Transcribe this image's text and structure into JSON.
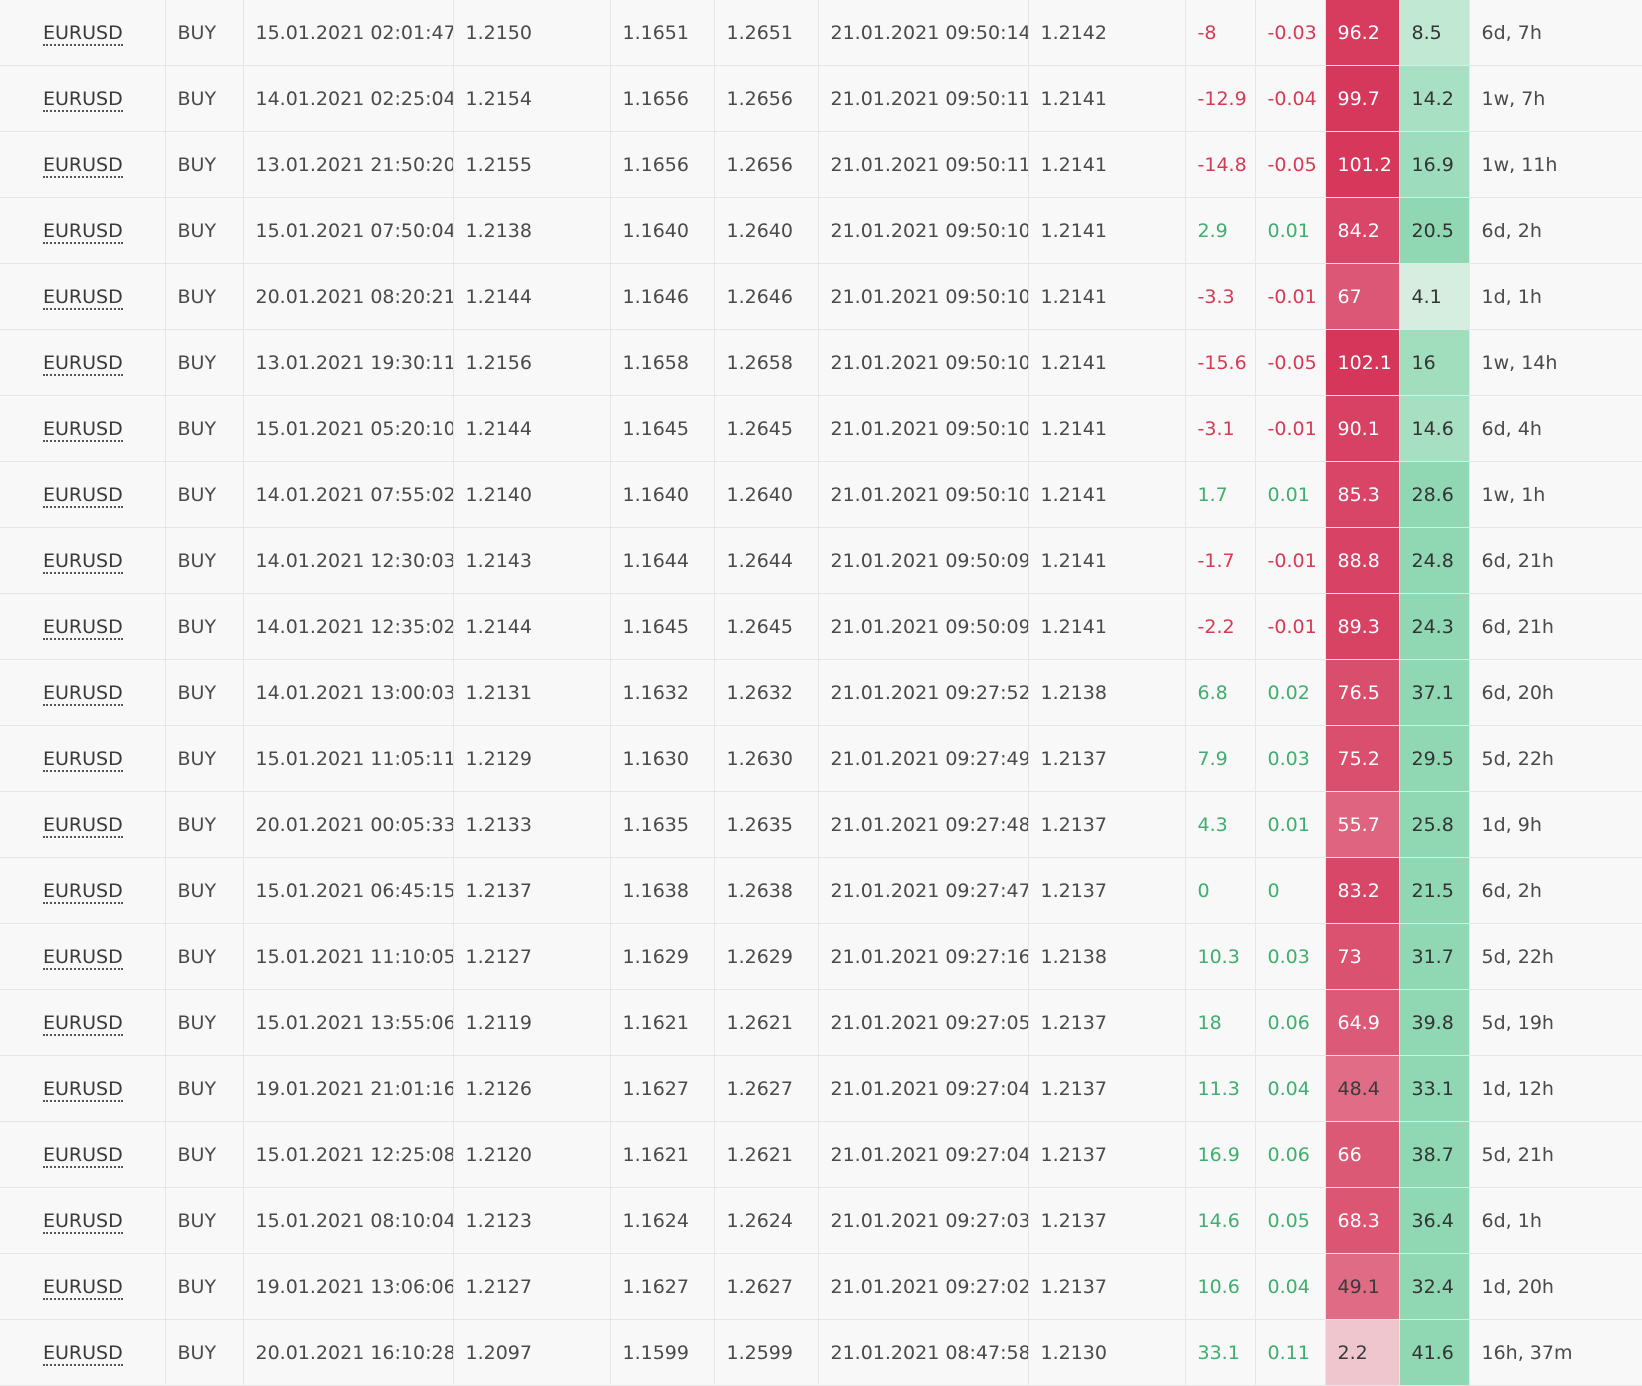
{
  "colors": {
    "negative_text": "#d63b55",
    "positive_text": "#3fae6e",
    "risk_heat_low": "#f0c9d1",
    "risk_heat_high": "#d6365a",
    "reward_heat_low": "#d5eee0",
    "reward_heat_high": "#8fd8b3"
  },
  "rows": [
    {
      "symbol": "EURUSD",
      "side": "BUY",
      "open_time": "15.01.2021 02:01:47",
      "open_price": "1.2150",
      "stop_loss": "1.1651",
      "take_profit": "1.2651",
      "close_time": "21.01.2021 09:50:14",
      "close_price": "1.2142",
      "pips": "-8",
      "profit": "-0.03",
      "risk": "96.2",
      "reward": "8.5",
      "duration": "6d, 7h"
    },
    {
      "symbol": "EURUSD",
      "side": "BUY",
      "open_time": "14.01.2021 02:25:04",
      "open_price": "1.2154",
      "stop_loss": "1.1656",
      "take_profit": "1.2656",
      "close_time": "21.01.2021 09:50:11",
      "close_price": "1.2141",
      "pips": "-12.9",
      "profit": "-0.04",
      "risk": "99.7",
      "reward": "14.2",
      "duration": "1w, 7h"
    },
    {
      "symbol": "EURUSD",
      "side": "BUY",
      "open_time": "13.01.2021 21:50:20",
      "open_price": "1.2155",
      "stop_loss": "1.1656",
      "take_profit": "1.2656",
      "close_time": "21.01.2021 09:50:11",
      "close_price": "1.2141",
      "pips": "-14.8",
      "profit": "-0.05",
      "risk": "101.2",
      "reward": "16.9",
      "duration": "1w, 11h"
    },
    {
      "symbol": "EURUSD",
      "side": "BUY",
      "open_time": "15.01.2021 07:50:04",
      "open_price": "1.2138",
      "stop_loss": "1.1640",
      "take_profit": "1.2640",
      "close_time": "21.01.2021 09:50:10",
      "close_price": "1.2141",
      "pips": "2.9",
      "profit": "0.01",
      "risk": "84.2",
      "reward": "20.5",
      "duration": "6d, 2h"
    },
    {
      "symbol": "EURUSD",
      "side": "BUY",
      "open_time": "20.01.2021 08:20:21",
      "open_price": "1.2144",
      "stop_loss": "1.1646",
      "take_profit": "1.2646",
      "close_time": "21.01.2021 09:50:10",
      "close_price": "1.2141",
      "pips": "-3.3",
      "profit": "-0.01",
      "risk": "67",
      "reward": "4.1",
      "duration": "1d, 1h"
    },
    {
      "symbol": "EURUSD",
      "side": "BUY",
      "open_time": "13.01.2021 19:30:11",
      "open_price": "1.2156",
      "stop_loss": "1.1658",
      "take_profit": "1.2658",
      "close_time": "21.01.2021 09:50:10",
      "close_price": "1.2141",
      "pips": "-15.6",
      "profit": "-0.05",
      "risk": "102.1",
      "reward": "16",
      "duration": "1w, 14h"
    },
    {
      "symbol": "EURUSD",
      "side": "BUY",
      "open_time": "15.01.2021 05:20:10",
      "open_price": "1.2144",
      "stop_loss": "1.1645",
      "take_profit": "1.2645",
      "close_time": "21.01.2021 09:50:10",
      "close_price": "1.2141",
      "pips": "-3.1",
      "profit": "-0.01",
      "risk": "90.1",
      "reward": "14.6",
      "duration": "6d, 4h"
    },
    {
      "symbol": "EURUSD",
      "side": "BUY",
      "open_time": "14.01.2021 07:55:02",
      "open_price": "1.2140",
      "stop_loss": "1.1640",
      "take_profit": "1.2640",
      "close_time": "21.01.2021 09:50:10",
      "close_price": "1.2141",
      "pips": "1.7",
      "profit": "0.01",
      "risk": "85.3",
      "reward": "28.6",
      "duration": "1w, 1h"
    },
    {
      "symbol": "EURUSD",
      "side": "BUY",
      "open_time": "14.01.2021 12:30:03",
      "open_price": "1.2143",
      "stop_loss": "1.1644",
      "take_profit": "1.2644",
      "close_time": "21.01.2021 09:50:09",
      "close_price": "1.2141",
      "pips": "-1.7",
      "profit": "-0.01",
      "risk": "88.8",
      "reward": "24.8",
      "duration": "6d, 21h"
    },
    {
      "symbol": "EURUSD",
      "side": "BUY",
      "open_time": "14.01.2021 12:35:02",
      "open_price": "1.2144",
      "stop_loss": "1.1645",
      "take_profit": "1.2645",
      "close_time": "21.01.2021 09:50:09",
      "close_price": "1.2141",
      "pips": "-2.2",
      "profit": "-0.01",
      "risk": "89.3",
      "reward": "24.3",
      "duration": "6d, 21h"
    },
    {
      "symbol": "EURUSD",
      "side": "BUY",
      "open_time": "14.01.2021 13:00:03",
      "open_price": "1.2131",
      "stop_loss": "1.1632",
      "take_profit": "1.2632",
      "close_time": "21.01.2021 09:27:52",
      "close_price": "1.2138",
      "pips": "6.8",
      "profit": "0.02",
      "risk": "76.5",
      "reward": "37.1",
      "duration": "6d, 20h"
    },
    {
      "symbol": "EURUSD",
      "side": "BUY",
      "open_time": "15.01.2021 11:05:11",
      "open_price": "1.2129",
      "stop_loss": "1.1630",
      "take_profit": "1.2630",
      "close_time": "21.01.2021 09:27:49",
      "close_price": "1.2137",
      "pips": "7.9",
      "profit": "0.03",
      "risk": "75.2",
      "reward": "29.5",
      "duration": "5d, 22h"
    },
    {
      "symbol": "EURUSD",
      "side": "BUY",
      "open_time": "20.01.2021 00:05:33",
      "open_price": "1.2133",
      "stop_loss": "1.1635",
      "take_profit": "1.2635",
      "close_time": "21.01.2021 09:27:48",
      "close_price": "1.2137",
      "pips": "4.3",
      "profit": "0.01",
      "risk": "55.7",
      "reward": "25.8",
      "duration": "1d, 9h"
    },
    {
      "symbol": "EURUSD",
      "side": "BUY",
      "open_time": "15.01.2021 06:45:15",
      "open_price": "1.2137",
      "stop_loss": "1.1638",
      "take_profit": "1.2638",
      "close_time": "21.01.2021 09:27:47",
      "close_price": "1.2137",
      "pips": "0",
      "profit": "0",
      "risk": "83.2",
      "reward": "21.5",
      "duration": "6d, 2h"
    },
    {
      "symbol": "EURUSD",
      "side": "BUY",
      "open_time": "15.01.2021 11:10:05",
      "open_price": "1.2127",
      "stop_loss": "1.1629",
      "take_profit": "1.2629",
      "close_time": "21.01.2021 09:27:16",
      "close_price": "1.2138",
      "pips": "10.3",
      "profit": "0.03",
      "risk": "73",
      "reward": "31.7",
      "duration": "5d, 22h"
    },
    {
      "symbol": "EURUSD",
      "side": "BUY",
      "open_time": "15.01.2021 13:55:06",
      "open_price": "1.2119",
      "stop_loss": "1.1621",
      "take_profit": "1.2621",
      "close_time": "21.01.2021 09:27:05",
      "close_price": "1.2137",
      "pips": "18",
      "profit": "0.06",
      "risk": "64.9",
      "reward": "39.8",
      "duration": "5d, 19h"
    },
    {
      "symbol": "EURUSD",
      "side": "BUY",
      "open_time": "19.01.2021 21:01:16",
      "open_price": "1.2126",
      "stop_loss": "1.1627",
      "take_profit": "1.2627",
      "close_time": "21.01.2021 09:27:04",
      "close_price": "1.2137",
      "pips": "11.3",
      "profit": "0.04",
      "risk": "48.4",
      "reward": "33.1",
      "duration": "1d, 12h"
    },
    {
      "symbol": "EURUSD",
      "side": "BUY",
      "open_time": "15.01.2021 12:25:08",
      "open_price": "1.2120",
      "stop_loss": "1.1621",
      "take_profit": "1.2621",
      "close_time": "21.01.2021 09:27:04",
      "close_price": "1.2137",
      "pips": "16.9",
      "profit": "0.06",
      "risk": "66",
      "reward": "38.7",
      "duration": "5d, 21h"
    },
    {
      "symbol": "EURUSD",
      "side": "BUY",
      "open_time": "15.01.2021 08:10:04",
      "open_price": "1.2123",
      "stop_loss": "1.1624",
      "take_profit": "1.2624",
      "close_time": "21.01.2021 09:27:03",
      "close_price": "1.2137",
      "pips": "14.6",
      "profit": "0.05",
      "risk": "68.3",
      "reward": "36.4",
      "duration": "6d, 1h"
    },
    {
      "symbol": "EURUSD",
      "side": "BUY",
      "open_time": "19.01.2021 13:06:06",
      "open_price": "1.2127",
      "stop_loss": "1.1627",
      "take_profit": "1.2627",
      "close_time": "21.01.2021 09:27:02",
      "close_price": "1.2137",
      "pips": "10.6",
      "profit": "0.04",
      "risk": "49.1",
      "reward": "32.4",
      "duration": "1d, 20h"
    },
    {
      "symbol": "EURUSD",
      "side": "BUY",
      "open_time": "20.01.2021 16:10:28",
      "open_price": "1.2097",
      "stop_loss": "1.1599",
      "take_profit": "1.2599",
      "close_time": "21.01.2021 08:47:58",
      "close_price": "1.2130",
      "pips": "33.1",
      "profit": "0.11",
      "risk": "2.2",
      "reward": "41.6",
      "duration": "16h, 37m"
    }
  ]
}
